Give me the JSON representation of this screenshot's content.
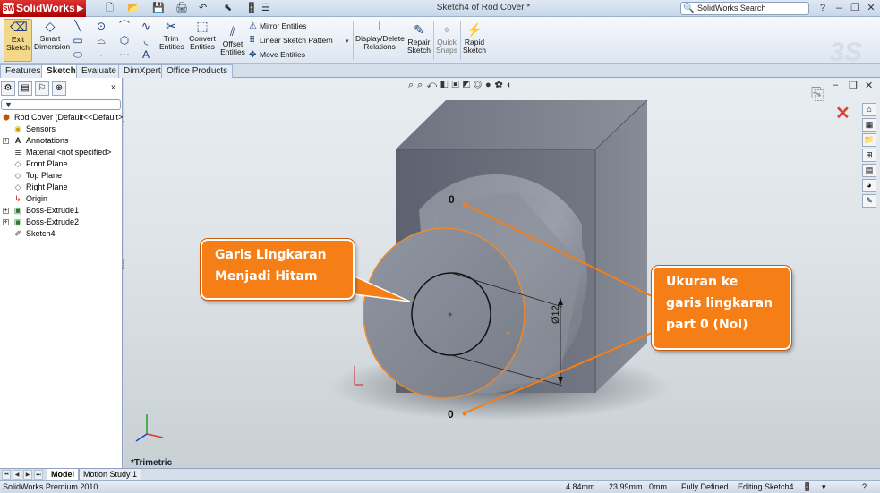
{
  "app": {
    "logo": "SolidWorks",
    "document_title": "Sketch4 of Rod Cover *",
    "search_placeholder": "SolidWorks Search",
    "help": "?",
    "minimize": "–",
    "restore": "❐",
    "close": "✕"
  },
  "toolbar": {
    "exit_sketch": [
      "Exit",
      "Sketch"
    ],
    "smart_dimension": [
      "Smart",
      "Dimension"
    ],
    "trim_entities": [
      "Trim",
      "Entities"
    ],
    "convert_entities": [
      "Convert",
      "Entities"
    ],
    "offset_entities": [
      "Offset",
      "Entities"
    ],
    "mirror_entities": "Mirror Entities",
    "linear_sketch_pattern": "Linear Sketch Pattern",
    "move_entities": "Move Entities",
    "display_delete_relations": [
      "Display/Delete",
      "Relations"
    ],
    "repair_sketch": [
      "Repair",
      "Sketch"
    ],
    "quick_snaps": [
      "Quick",
      "Snaps"
    ],
    "rapid_sketch": [
      "Rapid",
      "Sketch"
    ]
  },
  "tabs": [
    "Features",
    "Sketch",
    "Evaluate",
    "DimXpert",
    "Office Products"
  ],
  "active_tab": "Sketch",
  "feature_tree": {
    "root": "Rod Cover  (Default<<Default>_",
    "items": [
      {
        "label": "Sensors",
        "icon": "sensors-icon",
        "expandable": false
      },
      {
        "label": "Annotations",
        "icon": "annotations-icon",
        "expandable": true
      },
      {
        "label": "Material <not specified>",
        "icon": "material-icon",
        "expandable": false
      },
      {
        "label": "Front Plane",
        "icon": "plane-icon",
        "expandable": false
      },
      {
        "label": "Top Plane",
        "icon": "plane-icon",
        "expandable": false
      },
      {
        "label": "Right Plane",
        "icon": "plane-icon",
        "expandable": false
      },
      {
        "label": "Origin",
        "icon": "origin-icon",
        "expandable": false
      },
      {
        "label": "Boss-Extrude1",
        "icon": "extrude-icon",
        "expandable": true
      },
      {
        "label": "Boss-Extrude2",
        "icon": "extrude-icon",
        "expandable": true
      },
      {
        "label": "Sketch4",
        "icon": "sketch-icon",
        "expandable": false
      }
    ]
  },
  "viewport": {
    "view_label": "*Trimetric",
    "dimension_label": "Ø12",
    "dim_value_top": "0",
    "dim_value_bottom": "0"
  },
  "callouts": {
    "left": [
      "Garis Lingkaran",
      "Menjadi Hitam"
    ],
    "right": [
      "Ukuran ke",
      "garis lingkaran",
      "part 0 (Nol)"
    ]
  },
  "bottom_tabs": [
    "Model",
    "Motion Study 1"
  ],
  "status": {
    "product": "SolidWorks Premium 2010",
    "x": "4.84mm",
    "y": "23.99mm",
    "z": "0mm",
    "state": "Fully Defined",
    "editing": "Editing Sketch4",
    "help": "?"
  },
  "colors": {
    "callout": "#f57e16",
    "highlight": "#f0892a",
    "part": "#7a7f8a"
  }
}
